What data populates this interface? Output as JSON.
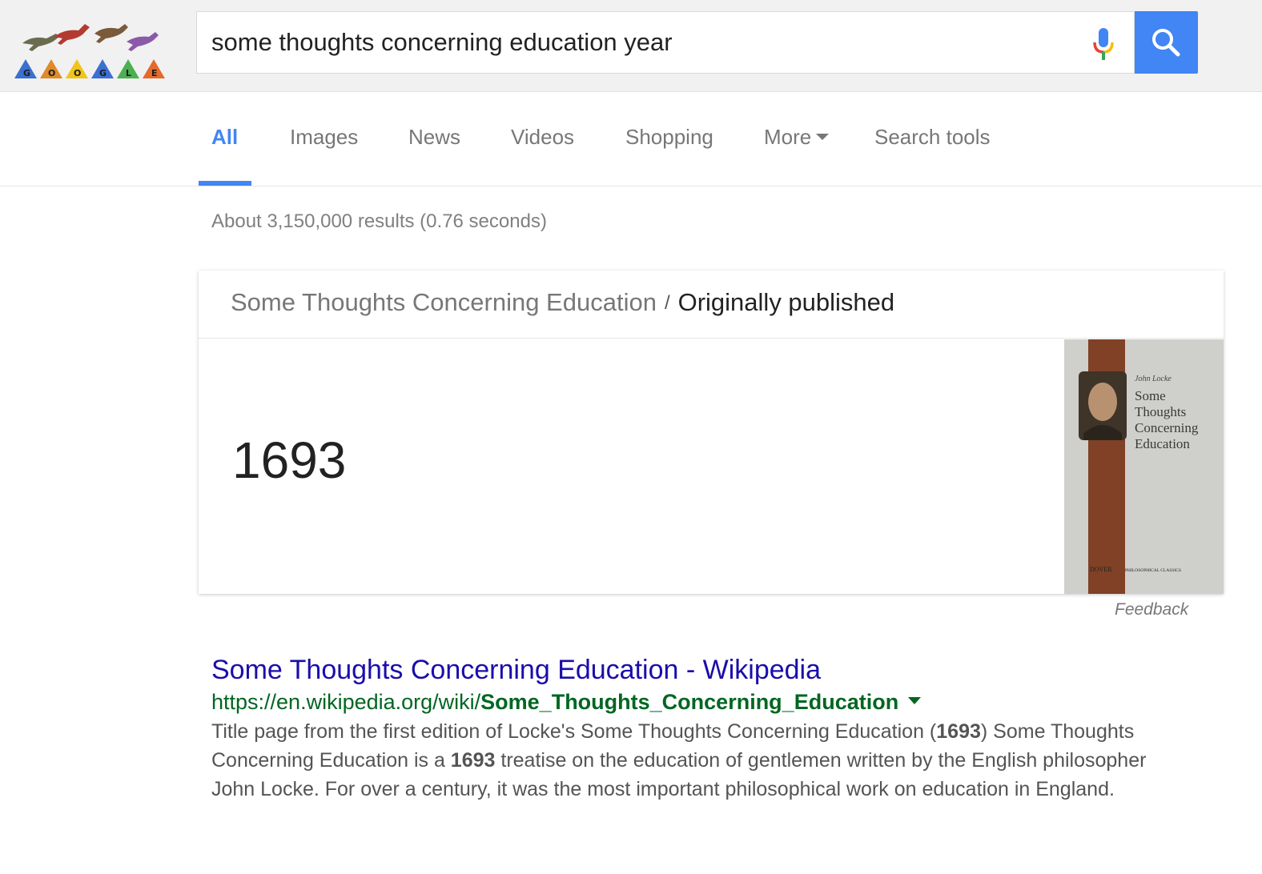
{
  "search": {
    "query": "some thoughts concerning education year",
    "mic_icon": "microphone-icon",
    "submit_icon": "search-icon",
    "button_color": "#4285f4"
  },
  "tabs": [
    {
      "label": "All",
      "active": true
    },
    {
      "label": "Images"
    },
    {
      "label": "News"
    },
    {
      "label": "Videos"
    },
    {
      "label": "Shopping"
    },
    {
      "label": "More"
    },
    {
      "label": "Search tools"
    }
  ],
  "stats": "About 3,150,000 results (0.76 seconds)",
  "answer_card": {
    "entity": "Some Thoughts Concerning Education",
    "separator": "/",
    "attribute": "Originally published",
    "value": "1693",
    "book_cover": {
      "author": "John Locke",
      "title_lines": [
        "Some",
        "Thoughts",
        "Concerning",
        "Education"
      ],
      "publisher": "DOVER",
      "series": "PHILOSOPHICAL CLASSICS"
    }
  },
  "feedback": "Feedback",
  "result": {
    "title": "Some Thoughts Concerning Education - Wikipedia",
    "url_prefix": "https://en.wikipedia.org/wiki/",
    "url_bold": "Some_Thoughts_Concerning_Education",
    "snippet": [
      {
        "text": "Title page from the first edition of Locke's Some Thoughts Concerning Education (",
        "bold": false
      },
      {
        "text": "1693",
        "bold": true
      },
      {
        "text": ") Some Thoughts Concerning Education is a ",
        "bold": false
      },
      {
        "text": "1693",
        "bold": true
      },
      {
        "text": " treatise on the education of gentlemen written by the English philosopher John Locke. For over a century, it was the most important philosophical work on education in England.",
        "bold": false
      }
    ]
  },
  "colors": {
    "accent": "#4285f4",
    "link": "#1a0dab",
    "url": "#006621"
  }
}
